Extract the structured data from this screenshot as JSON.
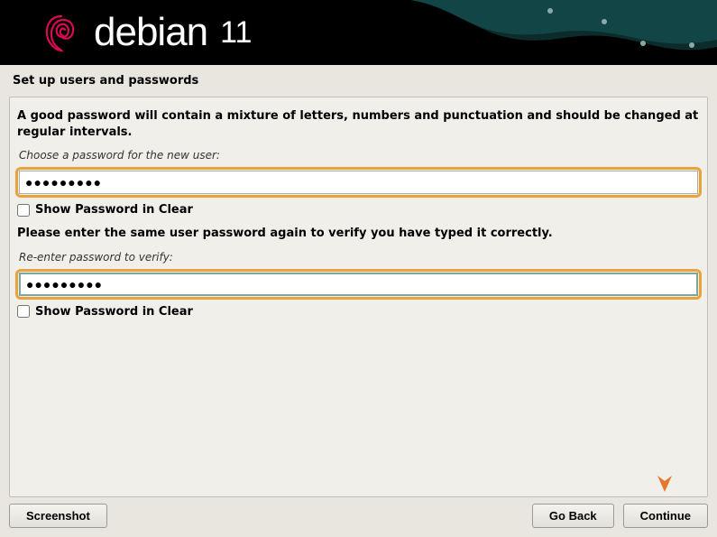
{
  "header": {
    "brand": "debian",
    "version": "11"
  },
  "page_title": "Set up users and passwords",
  "panel": {
    "instruction": "A good password will contain a mixture of letters, numbers and punctuation and should be changed at regular intervals.",
    "password1_label": "Choose a password for the new user:",
    "password1_value": "●●●●●●●●●",
    "show_clear1_label": "Show Password in Clear",
    "verify_instruction": "Please enter the same user password again to verify you have typed it correctly.",
    "password2_label": "Re-enter password to verify:",
    "password2_value": "●●●●●●●●●",
    "show_clear2_label": "Show Password in Clear"
  },
  "buttons": {
    "screenshot": "Screenshot",
    "go_back": "Go Back",
    "continue": "Continue"
  }
}
